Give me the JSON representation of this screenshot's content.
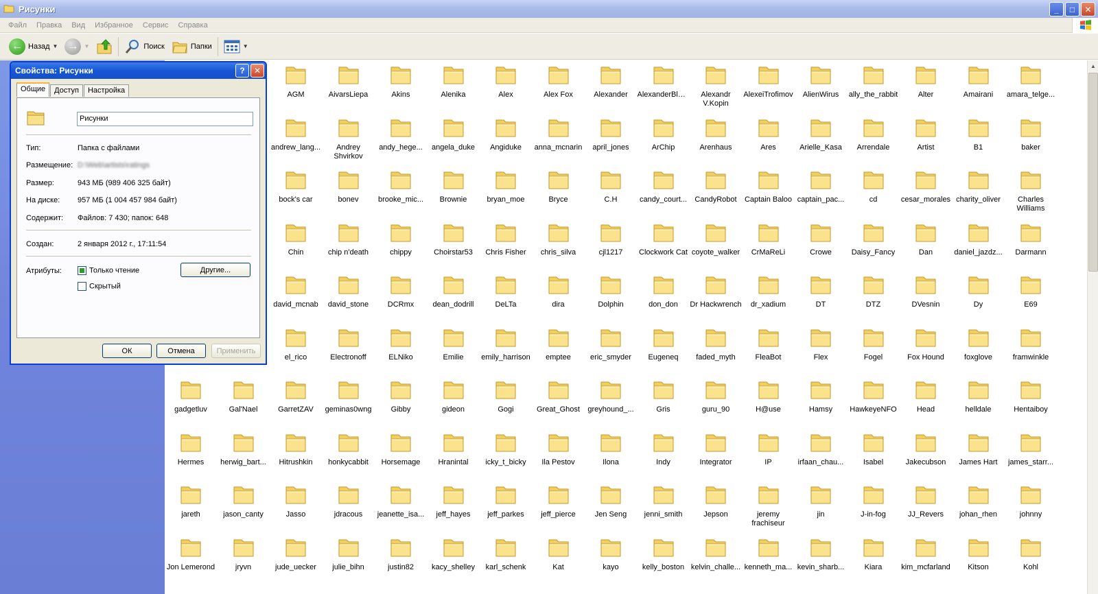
{
  "window": {
    "title": "Рисунки",
    "controls": [
      "_",
      "□",
      "✕"
    ]
  },
  "menu": [
    "Файл",
    "Правка",
    "Вид",
    "Избранное",
    "Сервис",
    "Справка"
  ],
  "toolbar": {
    "back_label": "Назад",
    "search_label": "Поиск",
    "folders_label": "Папки"
  },
  "dialog": {
    "title": "Свойства: Рисунки",
    "help_btn": "?",
    "close_btn": "✕",
    "tabs": [
      "Общие",
      "Доступ",
      "Настройка"
    ],
    "folder_name": "Рисунки",
    "type_label": "Тип:",
    "type_value": "Папка с файлами",
    "location_label": "Размещение:",
    "location_value": "D:\\Web\\artists\\ratings",
    "size_label": "Размер:",
    "size_value": "943 МБ (989 406 325 байт)",
    "disk_label": "На диске:",
    "disk_value": "957 МБ (1 004 457 984 байт)",
    "contains_label": "Содержит:",
    "contains_value": "Файлов: 7 430; папок: 648",
    "created_label": "Создан:",
    "created_value": "2 января 2012 г., 17:11:54",
    "attributes_label": "Атрибуты:",
    "readonly_label": "Только чтение",
    "hidden_label": "Скрытый",
    "other_btn": "Другие...",
    "ok_btn": "ОК",
    "cancel_btn": "Отмена",
    "apply_btn": "Применить"
  },
  "folders": [
    "AGM",
    "AivarsLiepa",
    "Akins",
    "Alenika",
    "Alex",
    "Alex Fox",
    "Alexander",
    "AlexanderBlack",
    "Alexandr V.Kopin",
    "AlexeiTrofimov",
    "AlienWirus",
    "ally_the_rabbit",
    "Alter",
    "Amairani",
    "amara_telge...",
    "andrew_lang...",
    "Andrey Shvirkov",
    "andy_hege...",
    "angela_duke",
    "Angiduke",
    "anna_mcnarin",
    "april_jones",
    "ArChip",
    "Arenhaus",
    "Ares",
    "Arielle_Kasa",
    "Arrendale",
    "Artist",
    "B1",
    "baker",
    "bock's car",
    "bonev",
    "brooke_mic...",
    "Brownie",
    "bryan_moe",
    "Bryce",
    "C.H",
    "candy_court...",
    "CandyRobot",
    "Captain Baloo",
    "captain_pac...",
    "cd",
    "cesar_morales",
    "charity_oliver",
    "Charles Williams",
    "Chin",
    "chip n'death",
    "chippy",
    "Choirstar53",
    "Chris Fisher",
    "chris_silva",
    "cjl1217",
    "Clockwork Cat",
    "coyote_walker",
    "CrMaReLi",
    "Crowe",
    "Daisy_Fancy",
    "Dan",
    "daniel_jazdz...",
    "Darmann",
    "david_mcnab",
    "david_stone",
    "DCRmx",
    "dean_dodrill",
    "DeLTa",
    "dira",
    "Dolphin",
    "don_don",
    "Dr Hackwrench",
    "dr_xadium",
    "DT",
    "DTZ",
    "DVesnin",
    "Dy",
    "E69",
    "el_rico",
    "Electronoff",
    "ELNiko",
    "Emilie",
    "emily_harrison",
    "emptee",
    "eric_smyder",
    "Eugeneq",
    "faded_myth",
    "FleaBot",
    "Flex",
    "Fogel",
    "Fox Hound",
    "foxglove",
    "framwinkle",
    "gadgetluv",
    "Gal'Nael",
    "GarretZAV",
    "geminas0wng",
    "Gibby",
    "gideon",
    "Gogi",
    "Great_Ghost",
    "greyhound_...",
    "Gris",
    "guru_90",
    "H@use",
    "Hamsy",
    "HawkeyeNFO",
    "Head",
    "helldale",
    "Hentaiboy",
    "Hermes",
    "herwig_bart...",
    "Hitrushkin",
    "honkycabbit",
    "Horsemage",
    "Hranintal",
    "icky_t_bicky",
    "Ila Pestov",
    "Ilona",
    "Indy",
    "Integrator",
    "IP",
    "irfaan_chau...",
    "Isabel",
    "Jakecubson",
    "James Hart",
    "james_starr...",
    "jareth",
    "jason_canty",
    "Jasso",
    "jdracous",
    "jeanette_isa...",
    "jeff_hayes",
    "jeff_parkes",
    "jeff_pierce",
    "Jen Seng",
    "jenni_smith",
    "Jepson",
    "jeremy frachiseur",
    "jin",
    "J-in-fog",
    "JJ_Revers",
    "johan_rhen",
    "johnny",
    "Jon Lemerond",
    "jryvn",
    "jude_uecker",
    "julie_bihn",
    "justin82",
    "kacy_shelley",
    "karl_schenk",
    "Kat",
    "kayo",
    "kelly_boston",
    "kelvin_challe...",
    "kenneth_ma...",
    "kevin_sharb...",
    "Kiara",
    "kim_mcfarland",
    "Kitson",
    "Kohl"
  ]
}
